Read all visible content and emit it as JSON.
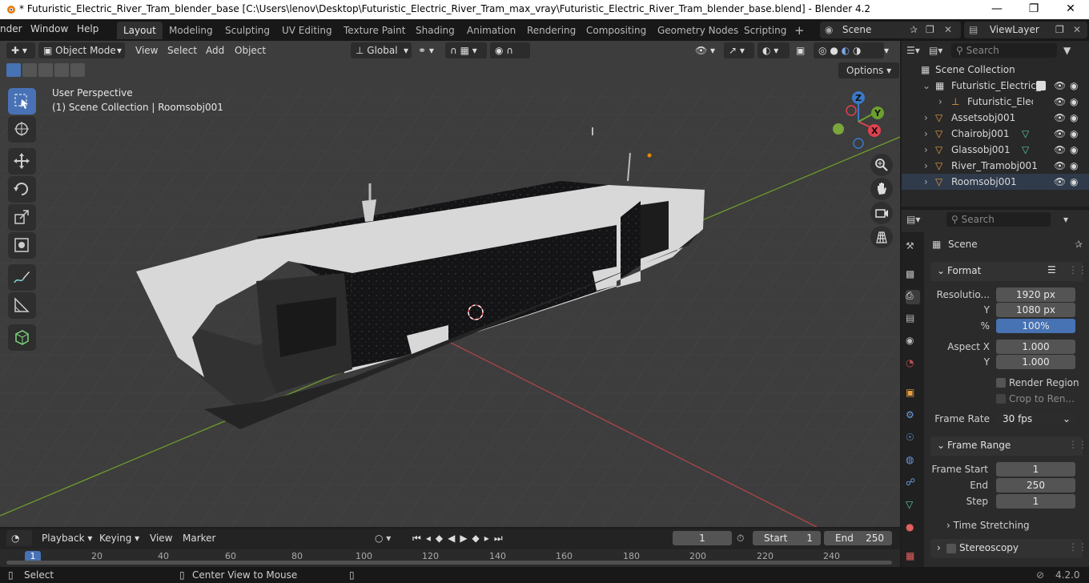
{
  "window": {
    "title": "* Futuristic_Electric_River_Tram_blender_base [C:\\Users\\lenov\\Desktop\\Futuristic_Electric_River_Tram_max_vray\\Futuristic_Electric_River_Tram_blender_base.blend] - Blender 4.2"
  },
  "menu": [
    "nder",
    "Window",
    "Help"
  ],
  "workspaces": [
    "Layout",
    "Modeling",
    "Sculpting",
    "UV Editing",
    "Texture Paint",
    "Shading",
    "Animation",
    "Rendering",
    "Compositing",
    "Geometry Nodes",
    "Scripting"
  ],
  "scene_name": "Scene",
  "view_layer": "ViewLayer",
  "viewport": {
    "mode": "Object Mode",
    "menus": [
      "View",
      "Select",
      "Add",
      "Object"
    ],
    "transform": "Global",
    "options_label": "Options",
    "info_line1": "User Perspective",
    "info_line2": "(1) Scene Collection | Roomsobj001"
  },
  "gizmo": {
    "z": "Z",
    "y": "Y",
    "x": "X"
  },
  "outliner": {
    "search_placeholder": "Search",
    "root": "Scene Collection",
    "items": [
      {
        "label": "Futuristic_Electric_"
      },
      {
        "label": "Futuristic_Elect"
      },
      {
        "label": "Assetsobj001"
      },
      {
        "label": "Chairobj001"
      },
      {
        "label": "Glassobj001"
      },
      {
        "label": "River_Tramobj001"
      },
      {
        "label": "Roomsobj001"
      }
    ]
  },
  "properties": {
    "search_placeholder": "Search",
    "context": "Scene",
    "format_header": "Format",
    "resolution_label": "Resolutio...",
    "res_x": "1920 px",
    "y_label": "Y",
    "res_y": "1080 px",
    "percent_label": "%",
    "percent": "100%",
    "aspect_label": "Aspect X",
    "aspect_x": "1.000",
    "aspect_y": "1.000",
    "render_region": "Render Region",
    "crop": "Crop to Ren...",
    "frame_rate_label": "Frame Rate",
    "frame_rate": "30 fps",
    "frame_range_header": "Frame Range",
    "frame_start_label": "Frame Start",
    "frame_start": "1",
    "end_label": "End",
    "frame_end": "250",
    "step_label": "Step",
    "step": "1",
    "time_stretching": "Time Stretching",
    "stereoscopy": "Stereoscopy"
  },
  "timeline": {
    "menus": [
      "Playback",
      "Keying",
      "View",
      "Marker"
    ],
    "current_frame": "1",
    "start_label": "Start",
    "start": "1",
    "end_label": "End",
    "end": "250",
    "ticks": [
      "1",
      "20",
      "40",
      "60",
      "80",
      "100",
      "120",
      "140",
      "160",
      "180",
      "200",
      "220",
      "240"
    ]
  },
  "status": {
    "select": "Select",
    "center": "Center View to Mouse",
    "version": "4.2.0"
  }
}
